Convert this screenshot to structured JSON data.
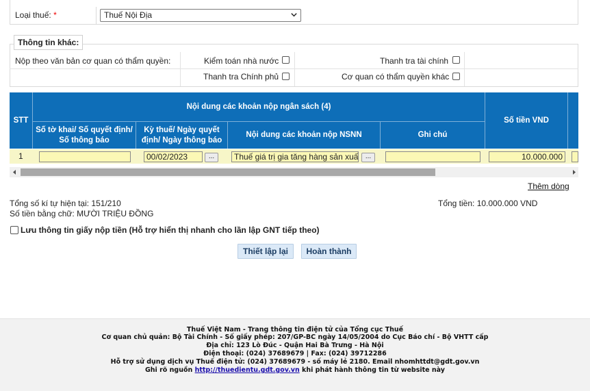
{
  "tax_type": {
    "label": "Loại thuế:",
    "required_mark": "*",
    "selected": "Thuế Nội Địa"
  },
  "other_info": {
    "legend": "Thông tin khác:",
    "submit_by_doc_label": "Nộp theo văn bản cơ quan có thẩm quyền:",
    "options": {
      "state_audit": "Kiểm toán nhà nước",
      "finance_inspect": "Thanh tra tài chính",
      "gov_inspect": "Thanh tra Chính phủ",
      "other_authority": "Cơ quan có thẩm quyền khác"
    }
  },
  "table": {
    "headers": {
      "stt": "STT",
      "group": "Nội dung các khoản nộp ngân sách (4)",
      "doc_no": "Số tờ khai/ Số quyết định/ Số thông báo",
      "period": "Kỳ thuế/ Ngày quyết định/ Ngày thông báo",
      "content": "Nội dung các khoản nộp NSNN",
      "note": "Ghi chú",
      "amount": "Số tiền VND"
    },
    "rows": [
      {
        "stt": "1",
        "doc_no": "",
        "period": "00/02/2023",
        "content": "Thuế giá trị gia tăng hàng sản xuất",
        "note": "",
        "amount": "10.000.000",
        "dots": "..."
      }
    ]
  },
  "add_row": "Thêm dòng",
  "char_count": "Tổng số kí tự hiện tại: 151/210",
  "total": "Tổng tiền: 10.000.000 VND",
  "amount_in_words": "Số tiền bằng chữ: MƯỜI TRIỆU ĐỒNG",
  "save_info_label": "Lưu thông tin giấy nộp tiền (Hỗ trợ hiển thị nhanh cho lần lập GNT tiếp theo)",
  "buttons": {
    "reset": "Thiết lập lại",
    "finish": "Hoàn thành"
  },
  "footer": {
    "line1": "Thuế Việt Nam - Trang thông tin điện tử của Tổng cục Thuế",
    "line2": "Cơ quan chủ quản: Bộ Tài Chính - Số giấy phép: 207/GP-BC ngày 14/05/2004 do Cục Báo chí - Bộ VHTT cấp",
    "line3": "Địa chỉ: 123 Lò Đúc - Quận Hai Bà Trưng - Hà Nội",
    "line4": "Điện thoại: (024) 37689679 | Fax: (024) 39712286",
    "line5": "Hỗ trợ sử dụng dịch vụ Thuế điện tử: (024) 37689679 - số máy lẻ 2180. Email nhomhttdt@gdt.gov.vn",
    "line6_pre": "Ghi rõ nguồn",
    "line6_link": "http://thuedientu.gdt.gov.vn",
    "line6_post": "khi phát hành thông tin từ website này"
  }
}
